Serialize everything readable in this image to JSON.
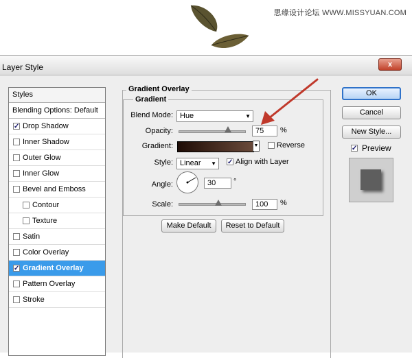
{
  "watermark": "思缘设计论坛 WWW.MISSYUAN.COM",
  "dialog": {
    "title": "Layer Style",
    "close_label": "x"
  },
  "styles_panel": {
    "header": "Styles",
    "blending_options": "Blending Options: Default",
    "items": [
      {
        "label": "Drop Shadow",
        "checked": true
      },
      {
        "label": "Inner Shadow",
        "checked": false
      },
      {
        "label": "Outer Glow",
        "checked": false
      },
      {
        "label": "Inner Glow",
        "checked": false
      },
      {
        "label": "Bevel and Emboss",
        "checked": false
      },
      {
        "label": "Contour",
        "checked": false
      },
      {
        "label": "Texture",
        "checked": false
      },
      {
        "label": "Satin",
        "checked": false
      },
      {
        "label": "Color Overlay",
        "checked": false
      },
      {
        "label": "Gradient Overlay",
        "checked": true
      },
      {
        "label": "Pattern Overlay",
        "checked": false
      },
      {
        "label": "Stroke",
        "checked": false
      }
    ]
  },
  "gradient_overlay": {
    "section_title": "Gradient Overlay",
    "group_title": "Gradient",
    "blend_mode_label": "Blend Mode:",
    "blend_mode_value": "Hue",
    "opacity_label": "Opacity:",
    "opacity_value": "75",
    "opacity_unit": "%",
    "opacity_level": 0.75,
    "gradient_label": "Gradient:",
    "gradient_colors": [
      "#1e0c06",
      "#6a4a3a"
    ],
    "reverse_label": "Reverse",
    "reverse_checked": false,
    "style_label": "Style:",
    "style_value": "Linear",
    "align_label": "Align with Layer",
    "align_checked": true,
    "angle_label": "Angle:",
    "angle_value": "30",
    "angle_unit": "°",
    "scale_label": "Scale:",
    "scale_value": "100",
    "scale_unit": "%",
    "scale_level": 0.6,
    "make_default_label": "Make Default",
    "reset_default_label": "Reset to Default"
  },
  "actions": {
    "ok_label": "OK",
    "cancel_label": "Cancel",
    "new_style_label": "New Style...",
    "preview_label": "Preview",
    "preview_checked": true
  },
  "colors": {
    "selection": "#3a9bea",
    "arrow": "#c0392b",
    "preview_swatch": "#5e5e5e"
  }
}
